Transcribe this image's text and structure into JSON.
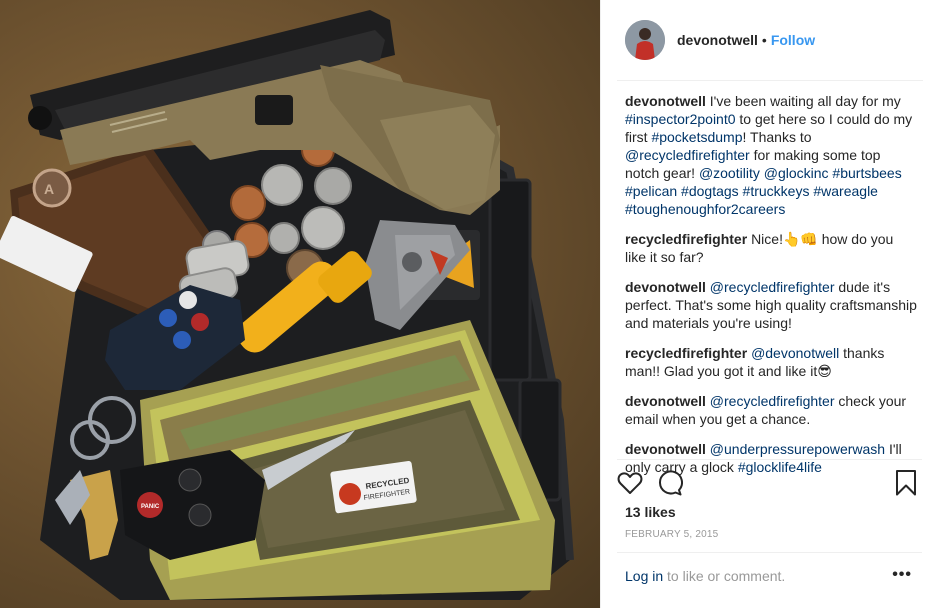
{
  "post": {
    "username": "devonotwell",
    "separator": "•",
    "follow_label": "Follow",
    "avatar_icon": "user-avatar"
  },
  "comments": [
    {
      "user": "devonotwell",
      "parts": [
        {
          "t": "I've been waiting all day for my ",
          "tag": false
        },
        {
          "t": "#inspector2point0",
          "tag": true
        },
        {
          "t": " to get here so I could do my first ",
          "tag": false
        },
        {
          "t": "#pocketsdump",
          "tag": true
        },
        {
          "t": "! Thanks to ",
          "tag": false
        },
        {
          "t": "@recycledfirefighter",
          "tag": true
        },
        {
          "t": " for making some top notch gear! ",
          "tag": false
        },
        {
          "t": "@zootility",
          "tag": true
        },
        {
          "t": " ",
          "tag": false
        },
        {
          "t": "@glockinc",
          "tag": true
        },
        {
          "t": " ",
          "tag": false
        },
        {
          "t": "#burtsbees",
          "tag": true
        },
        {
          "t": " ",
          "tag": false
        },
        {
          "t": "#pelican",
          "tag": true
        },
        {
          "t": " ",
          "tag": false
        },
        {
          "t": "#dogtags",
          "tag": true
        },
        {
          "t": " ",
          "tag": false
        },
        {
          "t": "#truckkeys",
          "tag": true
        },
        {
          "t": " ",
          "tag": false
        },
        {
          "t": "#wareagle",
          "tag": true
        },
        {
          "t": " ",
          "tag": false
        },
        {
          "t": "#toughenoughfor2careers",
          "tag": true
        }
      ]
    },
    {
      "user": "recycledfirefighter",
      "parts": [
        {
          "t": "Nice!👆👊 how do you like it so far?",
          "tag": false
        }
      ]
    },
    {
      "user": "devonotwell",
      "parts": [
        {
          "t": "@recycledfirefighter",
          "tag": true
        },
        {
          "t": " dude it's perfect. That's some high quality craftsmanship and materials you're using!",
          "tag": false
        }
      ]
    },
    {
      "user": "recycledfirefighter",
      "parts": [
        {
          "t": "@devonotwell",
          "tag": true
        },
        {
          "t": " thanks man!! Glad you got it and like it😎",
          "tag": false
        }
      ]
    },
    {
      "user": "devonotwell",
      "parts": [
        {
          "t": "@recycledfirefighter",
          "tag": true
        },
        {
          "t": " check your email when you get a chance.",
          "tag": false
        }
      ]
    },
    {
      "user": "devonotwell",
      "parts": [
        {
          "t": "@underpressurepowerwash",
          "tag": true
        },
        {
          "t": " I'll only carry a glock ",
          "tag": false
        },
        {
          "t": "#glocklife4life",
          "tag": true
        }
      ]
    }
  ],
  "actions": {
    "like_icon": "heart-icon",
    "comment_icon": "comment-icon",
    "save_icon": "bookmark-icon"
  },
  "likes_label": "13 likes",
  "date_label": "FEBRUARY 5, 2015",
  "footer": {
    "login_link": "Log in",
    "login_suffix": " to like or comment.",
    "more_label": "•••"
  },
  "photo": {
    "patch_text_1": "RECYCLED",
    "patch_text_2": "FIREFIGHTER",
    "fob_panic": "PANIC",
    "colors": {
      "brand_blue": "#3897f0",
      "tag_blue": "#003569",
      "text": "#262626",
      "muted": "#999999"
    }
  }
}
